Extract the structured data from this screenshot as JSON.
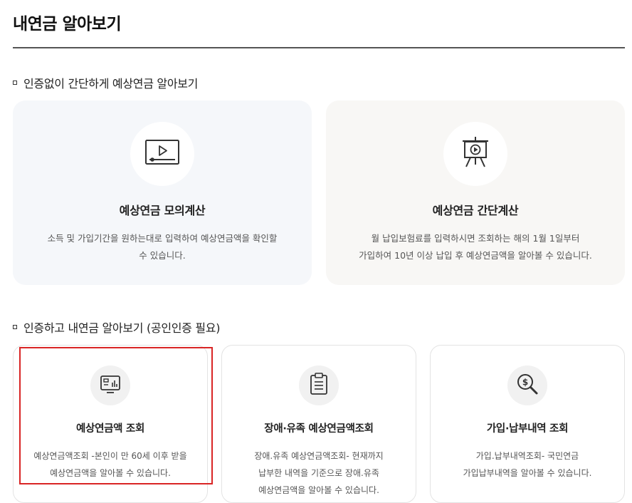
{
  "page": {
    "title": "내연금 알아보기"
  },
  "section_no_auth": {
    "title": "인증없이 간단하게 예상연금 알아보기",
    "cards": [
      {
        "icon": "video-play-icon",
        "title": "예상연금 모의계산",
        "desc_line1": "소득 및 가입기간을 원하는대로 입력하여 예상연금액을 확인할",
        "desc_line2": "수 있습니다."
      },
      {
        "icon": "presentation-board-icon",
        "title": "예상연금 간단계산",
        "desc_line1": "월 납입보험료를 입력하시면 조회하는 해의 1월 1일부터",
        "desc_line2": "가입하여 10년 이상 납입 후 예상연금액을 알아볼 수 있습니다."
      }
    ]
  },
  "section_auth": {
    "title": "인증하고 내연금 알아보기 (공인인증 필요)",
    "cards": [
      {
        "icon": "monitor-chart-icon",
        "title": "예상연금액 조회",
        "desc_line1": "예상연금액조회 -본인이 만 60세 이후 받을",
        "desc_line2": "예상연금액을 알아볼 수 있습니다."
      },
      {
        "icon": "clipboard-icon",
        "title": "장애·유족 예상연금액조회",
        "desc_line1": "장애.유족 예상연금액조회- 현재까지",
        "desc_line2": "납부한 내역을 기준으로 장애.유족",
        "desc_line3": "예상연금액을 알아볼 수 있습니다."
      },
      {
        "icon": "dollar-magnifier-icon",
        "title": "가입·납부내역 조회",
        "desc_line1": "가입.납부내역조회- 국민연금",
        "desc_line2": "가입납부내역을 알아볼 수 있습니다."
      }
    ]
  },
  "colors": {
    "highlight": "#d92525",
    "card_bg_a": "#f5f7fa",
    "card_bg_b": "#f8f7f5"
  }
}
